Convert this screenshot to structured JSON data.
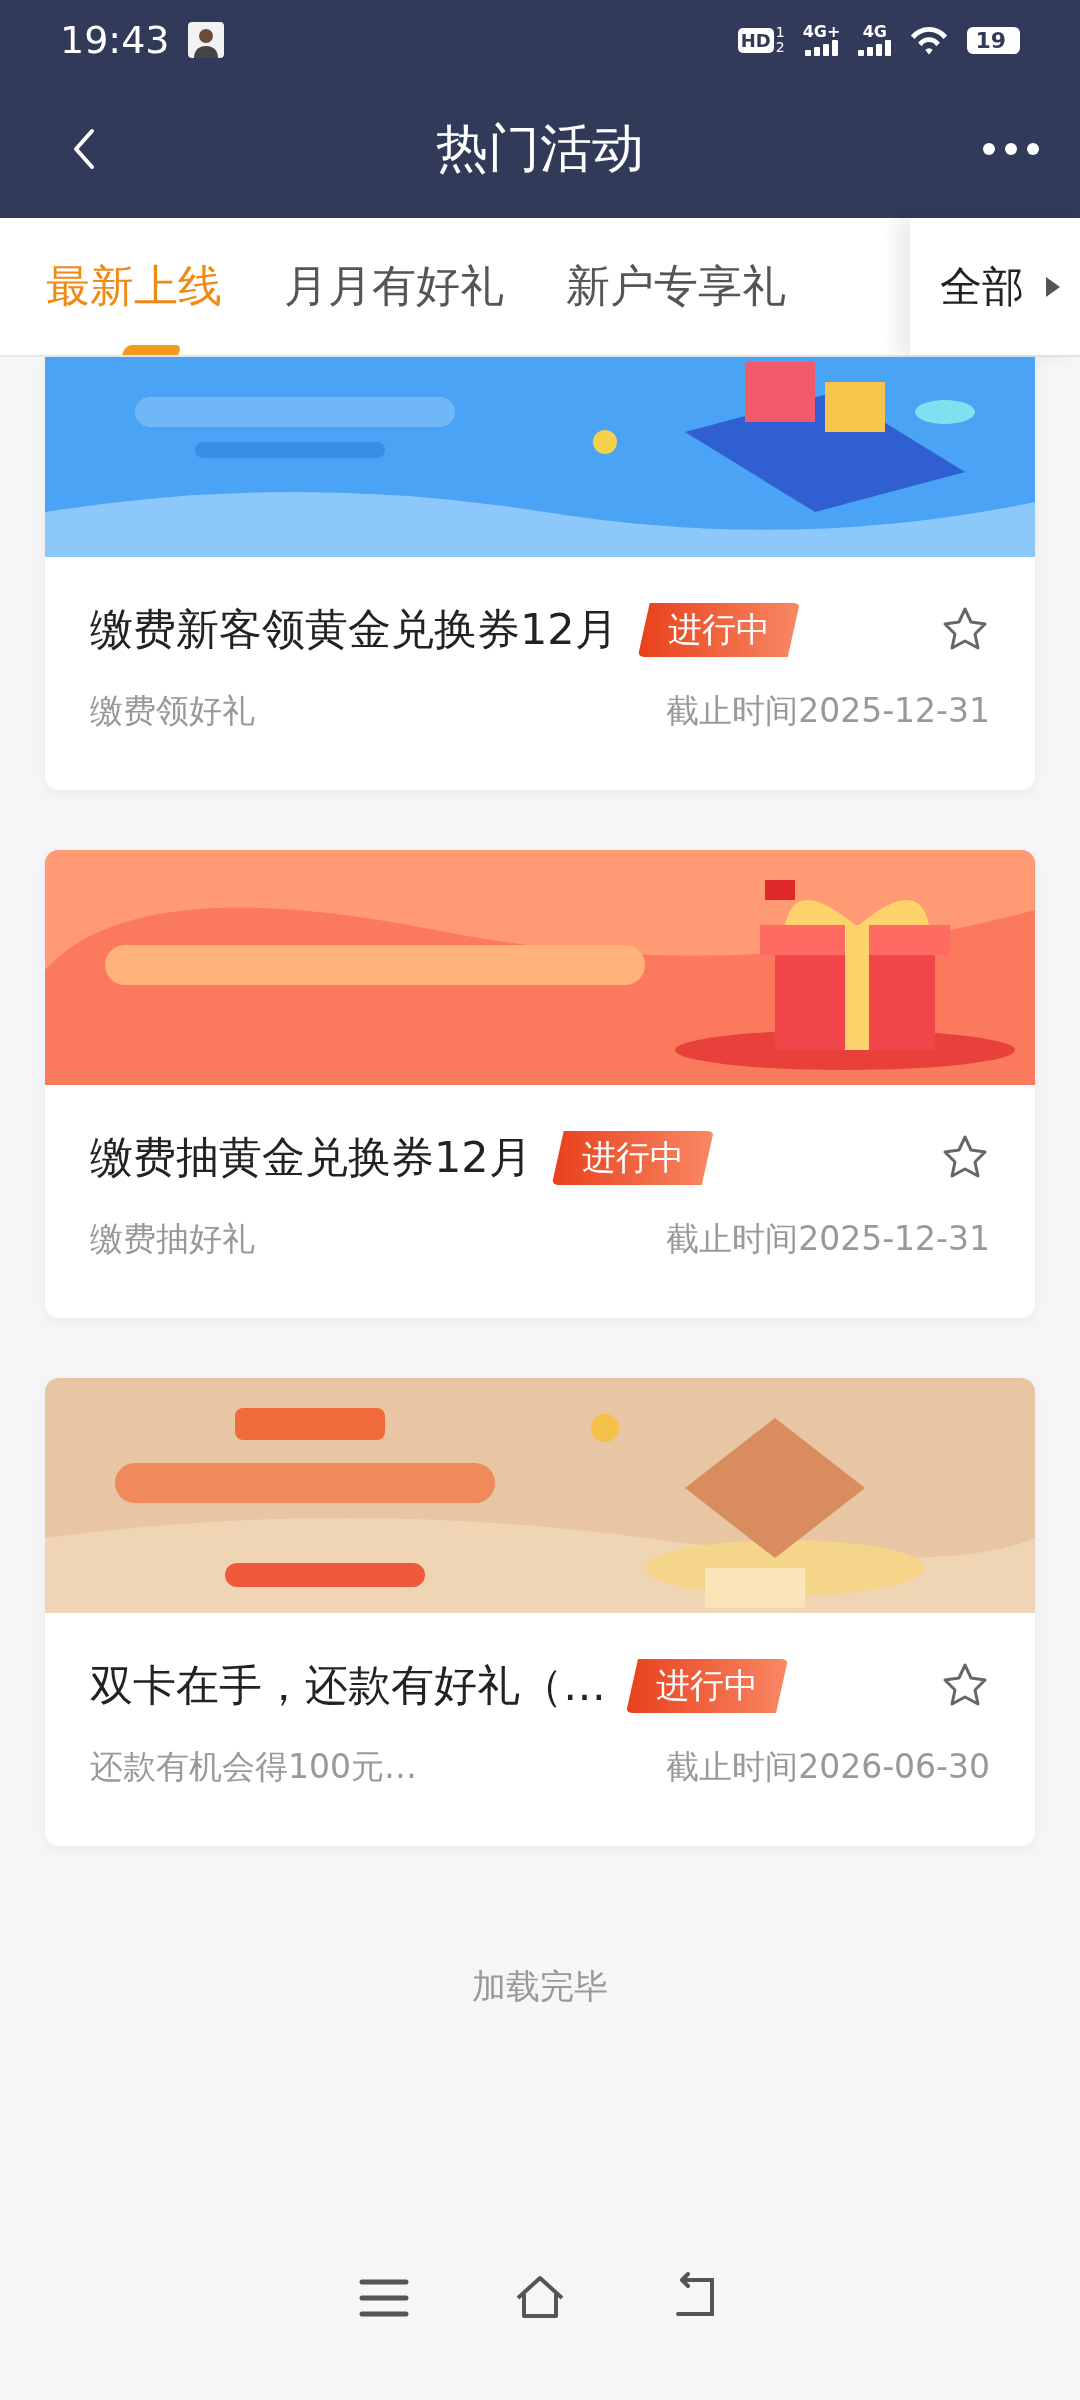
{
  "status_bar": {
    "time": "19:43",
    "hd": {
      "label": "HD",
      "sims": [
        "1",
        "2"
      ]
    },
    "signals": [
      "4G+",
      "4G"
    ],
    "battery": "19"
  },
  "header": {
    "title": "热门活动"
  },
  "tabs": [
    {
      "label": "最新上线",
      "selected": true
    },
    {
      "label": "月月有好礼",
      "selected": false
    },
    {
      "label": "新户专享礼",
      "selected": false
    }
  ],
  "all_tab": {
    "label": "全部"
  },
  "activities": [
    {
      "title": "缴费新客领黄金兑换券12月",
      "badge": "进行中",
      "subtitle": "缴费领好礼",
      "deadline": "截止时间2025-12-31",
      "favorited": false
    },
    {
      "title": "缴费抽黄金兑换券12月",
      "badge": "进行中",
      "subtitle": "缴费抽好礼",
      "deadline": "截止时间2025-12-31",
      "favorited": false
    },
    {
      "title": "双卡在手，还款有好礼（…",
      "badge": "进行中",
      "subtitle": "还款有机会得100元…",
      "deadline": "截止时间2026-06-30",
      "favorited": false
    }
  ],
  "footer": "加载完毕"
}
